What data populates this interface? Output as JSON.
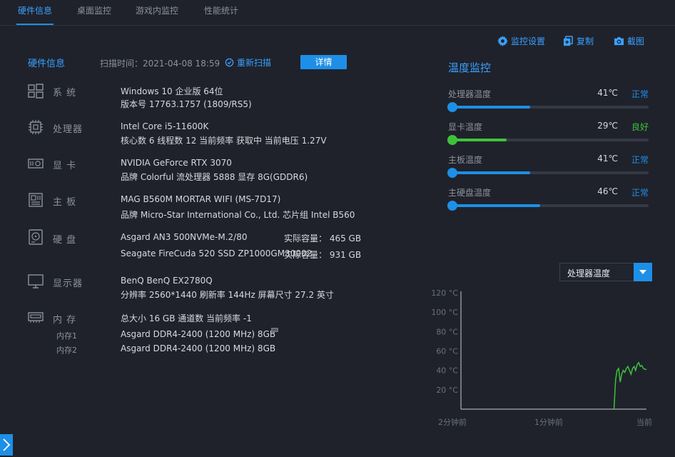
{
  "tabs": [
    "硬件信息",
    "桌面监控",
    "游戏内监控",
    "性能统计"
  ],
  "toolbar": {
    "monitor_settings": "监控设置",
    "copy": "复制",
    "screenshot": "截图"
  },
  "hardware": {
    "title": "硬件信息",
    "scan_time": "扫描时间：2021-04-08 18:59",
    "rescan": "重新扫描",
    "detail": "详情",
    "system": {
      "label": "系 统",
      "line1": "Windows 10 企业版 64位",
      "line2": "版本号 17763.1757 (1809/RS5)"
    },
    "cpu": {
      "label": "处理器",
      "line1": "Intel Core i5-11600K",
      "line2": "核心数 6  线程数 12  当前频率 获取中  当前电压 1.27V"
    },
    "gpu": {
      "label": "显 卡",
      "line1": "NVIDIA GeForce RTX 3070",
      "line2": "品牌 Colorful  流处理器 5888  显存 8G(GDDR6)"
    },
    "motherboard": {
      "label": "主 板",
      "line1": "MAG B560M MORTAR WIFI (MS-7D17)",
      "line2": "品牌 Micro-Star International Co., Ltd.  芯片组 Intel B560"
    },
    "disk": {
      "label": "硬 盘",
      "disk1_name": "Asgard AN3 500NVMe-M.2/80",
      "disk1_capacity": "实际容量： 465 GB",
      "disk2_name": "Seagate FireCuda 520 SSD ZP1000GM30002",
      "disk2_capacity": "实际容量： 931 GB"
    },
    "display": {
      "label": "显示器",
      "line1": "BenQ BenQ EX2780Q",
      "line2": "分辨率 2560*1440  刷新率 144Hz  屏幕尺寸 27.2 英寸"
    },
    "memory": {
      "label": "内 存",
      "line1": "总大小 16 GB  通道数  当前频率 -1",
      "slot1_label": "内存1",
      "slot1": "Asgard DDR4-2400 (1200 MHz) 8GB",
      "slot2_label": "内存2",
      "slot2": "Asgard DDR4-2400 (1200 MHz) 8GB"
    }
  },
  "temperature": {
    "title": "温度监控",
    "items": [
      {
        "name": "处理器温度",
        "value": "41℃",
        "status": "正常",
        "level": 0.4,
        "color": "#1e8fe6",
        "status_color": "#1e8fe6"
      },
      {
        "name": "显卡温度",
        "value": "29℃",
        "status": "良好",
        "level": 0.28,
        "color": "#3ec23a",
        "status_color": "#3ec23a"
      },
      {
        "name": "主板温度",
        "value": "41℃",
        "status": "正常",
        "level": 0.4,
        "color": "#1e8fe6",
        "status_color": "#1e8fe6"
      },
      {
        "name": "主硬盘温度",
        "value": "46℃",
        "status": "正常",
        "level": 0.45,
        "color": "#1e8fe6",
        "status_color": "#1e8fe6"
      }
    ],
    "selected_sensor": "处理器温度"
  },
  "chart_data": {
    "type": "line",
    "title": "",
    "xlabel": "",
    "ylabel": "",
    "y_ticks": [
      "120 °C",
      "100 °C",
      "80 °C",
      "60 °C",
      "40 °C",
      "20 °C"
    ],
    "y_tick_values": [
      120,
      100,
      80,
      60,
      40,
      20
    ],
    "x_ticks": [
      "2分钟前",
      "1分钟前",
      "当前"
    ],
    "ylim": [
      0,
      120
    ],
    "xlim": [
      -120,
      0
    ],
    "grid": false,
    "series": [
      {
        "color": "#3ec23a",
        "x": [
          -21,
          -20,
          -19,
          -18,
          -17,
          -16,
          -15,
          -14,
          -13,
          -12,
          -11,
          -10,
          -9,
          -8,
          -7,
          -6,
          -5,
          -4,
          -3,
          -2,
          -1,
          0
        ],
        "y": [
          0,
          30,
          40,
          42,
          28,
          36,
          40,
          38,
          42,
          44,
          40,
          36,
          42,
          44,
          40,
          46,
          48,
          44,
          45,
          42,
          41,
          41
        ]
      }
    ]
  },
  "colors": {
    "accent": "#1e8fe6",
    "good": "#3ec23a",
    "background": "#1f222b"
  }
}
